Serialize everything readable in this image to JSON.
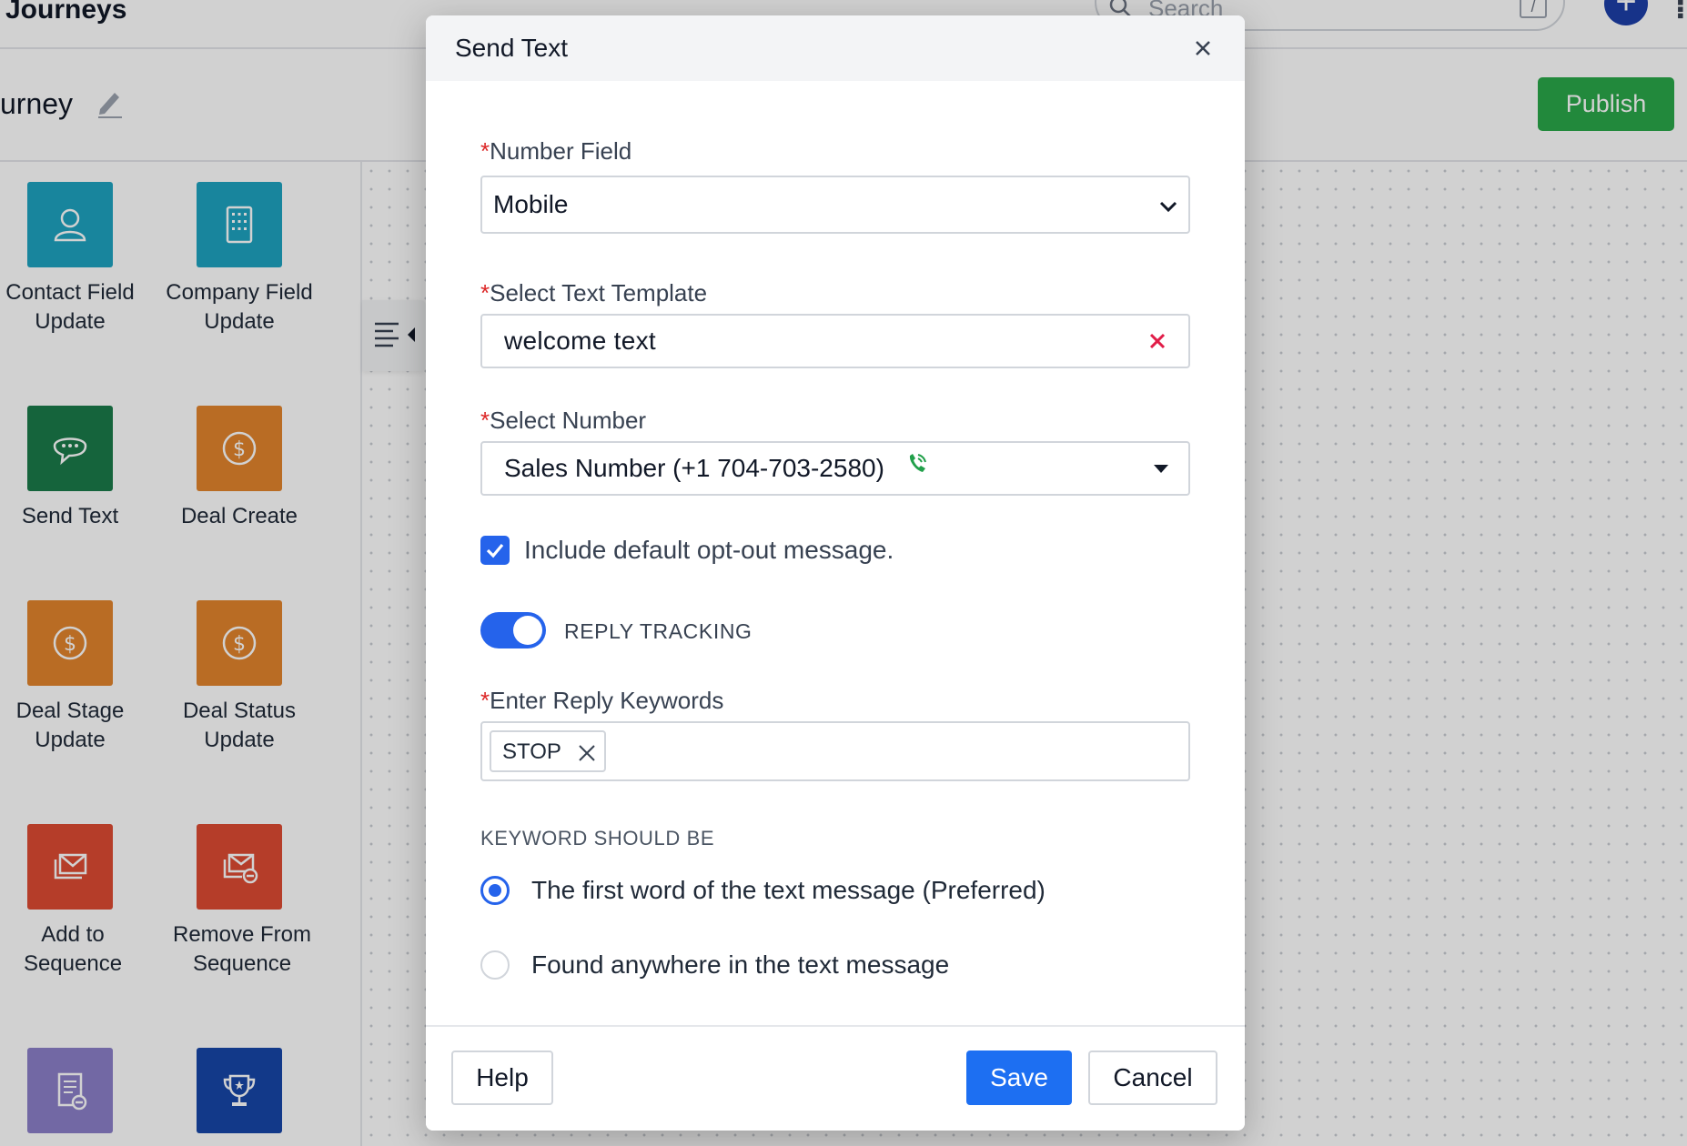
{
  "app": {
    "title": "Journeys",
    "search_placeholder": "Search",
    "search_shortcut": "/",
    "add_symbol": "+",
    "more_symbol": "⠇"
  },
  "journey": {
    "name": "urney",
    "publish_label": "Publish"
  },
  "palette": {
    "items": [
      {
        "label": "Contact Field Update",
        "icon": "user-icon",
        "color": "#1ea3c0"
      },
      {
        "label": "Company Field Update",
        "icon": "building-icon",
        "color": "#1ea3c0"
      },
      {
        "label": "Send Text",
        "icon": "chat-icon",
        "color": "#1a7a4a"
      },
      {
        "label": "Deal Create",
        "icon": "dollar-icon",
        "color": "#e2842d"
      },
      {
        "label": "Deal Stage Update",
        "icon": "dollar-icon",
        "color": "#e2842d"
      },
      {
        "label": "Deal Status Update",
        "icon": "dollar-icon",
        "color": "#e2842d"
      },
      {
        "label": "Add to Sequence",
        "icon": "mail-stack-icon",
        "color": "#dd4b32"
      },
      {
        "label": "Remove From Sequence",
        "icon": "mail-remove-icon",
        "color": "#dd4b32"
      },
      {
        "label": "",
        "icon": "document-icon",
        "color": "#8b7fc8"
      },
      {
        "label": "",
        "icon": "trophy-icon",
        "color": "#1646a8"
      }
    ]
  },
  "modal": {
    "title": "Send Text",
    "required_mark": "*",
    "number_field": {
      "label": "Number Field",
      "value": "Mobile"
    },
    "template": {
      "label": "Select Text Template",
      "value": "welcome text"
    },
    "select_number": {
      "label": "Select Number",
      "value": "Sales Number (+1 704-703-2580)"
    },
    "opt_out": {
      "label": "Include default opt-out message.",
      "checked": true
    },
    "reply_tracking": {
      "label": "REPLY TRACKING",
      "on": true
    },
    "keywords": {
      "label": "Enter Reply Keywords",
      "chips": [
        "STOP"
      ]
    },
    "keyword_position": {
      "label": "KEYWORD SHOULD BE",
      "options": [
        {
          "label": "The first word of the text message (Preferred)",
          "selected": true
        },
        {
          "label": "Found anywhere in the text message",
          "selected": false
        }
      ]
    },
    "footer": {
      "help_label": "Help",
      "save_label": "Save",
      "cancel_label": "Cancel"
    }
  },
  "colors": {
    "primary": "#1d6ff2",
    "publish": "#2aa84a",
    "required": "#dc2626",
    "clear": "#e11d48",
    "phone": "#22a04b"
  }
}
